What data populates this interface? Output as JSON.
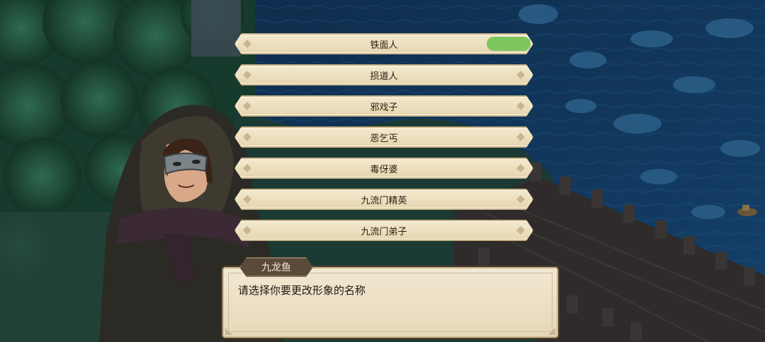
{
  "speaker": {
    "name": "九龙鱼"
  },
  "dialog": {
    "text": "请选择你要更改形象的名称"
  },
  "options": [
    {
      "label": "铁面人",
      "selected": true
    },
    {
      "label": "损道人",
      "selected": false
    },
    {
      "label": "邪戏子",
      "selected": false
    },
    {
      "label": "恶乞丐",
      "selected": false
    },
    {
      "label": "毒伢婆",
      "selected": false
    },
    {
      "label": "九流门精英",
      "selected": false
    },
    {
      "label": "九流门弟子",
      "selected": false
    }
  ],
  "colors": {
    "selected_marker": "#7dc65c",
    "option_bg": "#efe2c4",
    "water": "#123c63",
    "forest": "#1f4a38"
  }
}
